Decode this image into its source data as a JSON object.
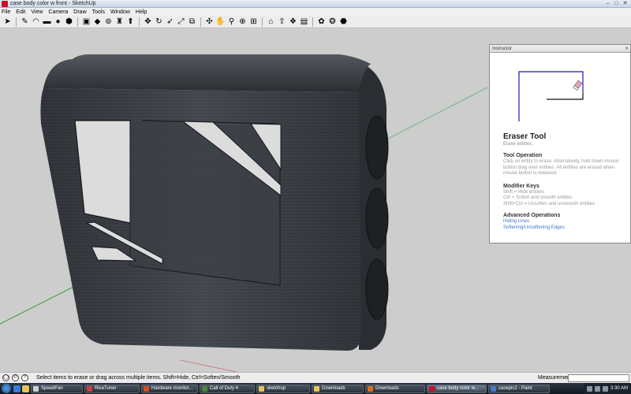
{
  "window": {
    "title": "case body color w front - SketchUp"
  },
  "menu": [
    "File",
    "Edit",
    "View",
    "Camera",
    "Draw",
    "Tools",
    "Window",
    "Help"
  ],
  "toolbar": [
    {
      "icon": "select-arrow-icon",
      "glyph": "➤"
    },
    {
      "icon": "pencil-icon",
      "glyph": "✎"
    },
    {
      "icon": "arc-icon",
      "glyph": "◠"
    },
    {
      "icon": "rectangle-icon",
      "glyph": "▬"
    },
    {
      "icon": "circle-icon",
      "glyph": "●"
    },
    {
      "icon": "polygon-icon",
      "glyph": "⬢"
    },
    {
      "icon": "make-component-icon",
      "glyph": "▣"
    },
    {
      "icon": "eraser-icon",
      "glyph": "◆"
    },
    {
      "icon": "tape-measure-icon",
      "glyph": "⊚"
    },
    {
      "icon": "paint-bucket-icon",
      "glyph": "♜"
    },
    {
      "icon": "push-pull-icon",
      "glyph": "⬆"
    },
    {
      "icon": "move-icon",
      "glyph": "✥"
    },
    {
      "icon": "rotate-icon",
      "glyph": "↻"
    },
    {
      "icon": "follow-me-icon",
      "glyph": "➶"
    },
    {
      "icon": "scale-icon",
      "glyph": "⤢"
    },
    {
      "icon": "offset-icon",
      "glyph": "⧉"
    },
    {
      "icon": "orbit-icon",
      "glyph": "✣"
    },
    {
      "icon": "pan-icon",
      "glyph": "✋"
    },
    {
      "icon": "zoom-icon",
      "glyph": "⚲"
    },
    {
      "icon": "zoom-window-icon",
      "glyph": "⊕"
    },
    {
      "icon": "zoom-extents-icon",
      "glyph": "⊞"
    },
    {
      "icon": "get-models-icon",
      "glyph": "⌂"
    },
    {
      "icon": "share-model-icon",
      "glyph": "⇪"
    },
    {
      "icon": "components-icon",
      "glyph": "❖"
    },
    {
      "icon": "get-photo-texture-icon",
      "glyph": "▤"
    },
    {
      "icon": "extensions-icon",
      "glyph": "✿"
    },
    {
      "icon": "place-model-icon",
      "glyph": "❂"
    },
    {
      "icon": "warehouse-icon",
      "glyph": "⬣"
    }
  ],
  "colors": {
    "axis_green": "#3c9a3c",
    "axis_red": "#c83232",
    "case_dark": "#3a3d42",
    "instructor_link": "#3a78c8"
  },
  "instructor": {
    "panel_title": "Instructor",
    "tool_name": "Eraser Tool",
    "tool_sub": "Erase entities.",
    "op_heading": "Tool Operation",
    "op_text": "Click on entity to erase. Alternatively, hold down mouse button drag over entities. All entities are erased when mouse button is released.",
    "mod_heading": "Modifier Keys",
    "mod_lines": [
      "Shift = Hide entities",
      "Ctrl = Soften and smooth entities",
      "Shift+Ctrl = Unsoften and unsmooth entities"
    ],
    "adv_heading": "Advanced Operations",
    "adv_links": [
      "Hiding Lines",
      "Softening/Unsoftening Edges"
    ]
  },
  "status": {
    "message": "Select items to erase or drag across multiple items. Shift=Hide, Ctrl=Soften/Smooth",
    "measurements_label": "Measurements"
  },
  "taskbar": {
    "items": [
      {
        "label": "SpeedFan",
        "color": "#d0d0d0"
      },
      {
        "label": "RivaTuner",
        "color": "#c84040"
      },
      {
        "label": "Hardware monitor...",
        "color": "#d84e1e"
      },
      {
        "label": "Call of Duty 4",
        "color": "#4a8a3a"
      },
      {
        "label": "sketchup",
        "color": "#e6c45a"
      },
      {
        "label": "Downloads",
        "color": "#e6c45a"
      },
      {
        "label": "Downloads",
        "color": "#e07020"
      },
      {
        "label": "case body color w...",
        "color": "#c8102e"
      },
      {
        "label": "casepic2 - Paint",
        "color": "#4a7ac8"
      }
    ],
    "time": "3:30 AM"
  }
}
